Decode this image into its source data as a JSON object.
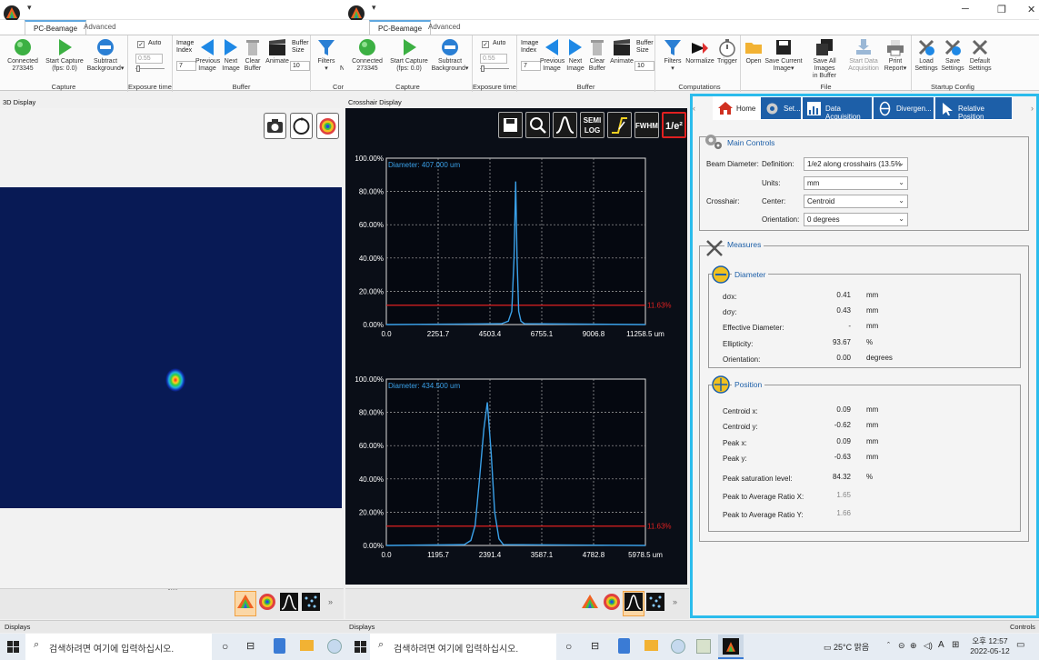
{
  "left_window": {
    "ribbon_tabs": [
      "PC-Beamage",
      "Advanced"
    ],
    "capture": {
      "connected_label": "Connected",
      "connected_id": "273345",
      "start_capture": "Start Capture",
      "fps": "(fps: 0.0)",
      "subtract": "Subtract",
      "background": "Background",
      "group_label": "Capture"
    },
    "exposure": {
      "auto_label": "Auto",
      "value": "0.55",
      "group_label": "Exposure time"
    },
    "buffer": {
      "image_index_label": "Image Index",
      "image_index_value": "7",
      "previous": "Previous",
      "next": "Next",
      "image": "Image",
      "clear": "Clear",
      "buffer_word": "Buffer",
      "animate": "Animate",
      "buffer_size_label": "Buffer Size",
      "buffer_size_value": "10",
      "group_label": "Buffer"
    },
    "filters_label": "Filters",
    "n_label": "N",
    "cor_label": "Cor",
    "panel_title": "3D Display"
  },
  "right_window": {
    "ribbon_tabs": [
      "PC-Beamage",
      "Advanced"
    ],
    "capture": {
      "connected_label": "Connected",
      "connected_id": "273345",
      "start_capture": "Start Capture",
      "fps": "(fps: 0.0)",
      "subtract": "Subtract",
      "background": "Background",
      "group_label": "Capture"
    },
    "exposure": {
      "auto_label": "Auto",
      "value": "0.55",
      "group_label": "Exposure time"
    },
    "buffer": {
      "image_index_label": "Image Index",
      "image_index_value": "7",
      "previous": "Previous",
      "next": "Next",
      "image": "Image",
      "clear": "Clear",
      "buffer_word": "Buffer",
      "animate": "Animate",
      "buffer_size_label": "Buffer Size",
      "buffer_size_value": "10",
      "group_label": "Buffer"
    },
    "computations": {
      "filters": "Filters",
      "normalize": "Normalize",
      "trigger": "Trigger",
      "group_label": "Computations"
    },
    "file": {
      "open": "Open",
      "save_current": "Save Current",
      "image": "Image",
      "save_all": "Save All Images",
      "in_buffer": "in Buffer",
      "start_data": "Start Data",
      "acquisition": "Acquisition",
      "print": "Print",
      "report": "Report",
      "group_label": "File"
    },
    "startup": {
      "load": "Load",
      "save": "Save",
      "default": "Default",
      "settings": "Settings",
      "group_label": "Startup Config"
    },
    "panel_title": "Crosshair Display",
    "toolbar_labels": [
      "SEMI LOG",
      "FWHM",
      "1/e²"
    ]
  },
  "chart_data": [
    {
      "type": "line",
      "title": "Diameter: 407.000 um",
      "x_ticks": [
        "0.0",
        "2251.7",
        "4503.4",
        "6755.1",
        "9006.8",
        "11258.5 um"
      ],
      "y_ticks": [
        "0.00%",
        "20.00%",
        "40.00%",
        "60.00%",
        "80.00%",
        "100.00%"
      ],
      "xlim": [
        0,
        11258.5
      ],
      "ylim": [
        0,
        100
      ],
      "threshold": {
        "value": 11.63,
        "label": "11.63%"
      },
      "x": [
        0,
        5000,
        5300,
        5450,
        5550,
        5620,
        5680,
        5750,
        5850,
        6000,
        11258.5
      ],
      "y": [
        0,
        0.5,
        2,
        8,
        40,
        86,
        40,
        8,
        2,
        0.5,
        0
      ],
      "grid": true
    },
    {
      "type": "line",
      "title": "Diameter: 434.500 um",
      "x_ticks": [
        "0.0",
        "1195.7",
        "2391.4",
        "3587.1",
        "4782.8",
        "5978.5 um"
      ],
      "y_ticks": [
        "0.00%",
        "20.00%",
        "40.00%",
        "60.00%",
        "80.00%",
        "100.00%"
      ],
      "xlim": [
        0,
        5978.5
      ],
      "ylim": [
        0,
        100
      ],
      "threshold": {
        "value": 11.63,
        "label": "11.63%"
      },
      "x": [
        0,
        1800,
        1950,
        2050,
        2150,
        2250,
        2330,
        2420,
        2500,
        2600,
        2700,
        5978.5
      ],
      "y": [
        0,
        0.5,
        3,
        12,
        40,
        70,
        86,
        55,
        20,
        4,
        0.5,
        0
      ],
      "grid": true
    }
  ],
  "right_panel": {
    "tabs": [
      "Home",
      "Set...",
      "Data Acquisition",
      "Divergen...",
      "Relative Position"
    ],
    "main_controls": {
      "title": "Main Controls",
      "beam_diameter_label": "Beam Diameter:",
      "definition_label": "Definition:",
      "definition_value": "1/e2 along crosshairs (13.5%",
      "units_label": "Units:",
      "units_value": "mm",
      "crosshair_label": "Crosshair:",
      "center_label": "Center:",
      "center_value": "Centroid",
      "orientation_label": "Orientation:",
      "orientation_value": "0 degrees"
    },
    "measures_title": "Measures",
    "diameter": {
      "title": "Diameter",
      "rows": [
        {
          "label": "dσx:",
          "value": "0.41",
          "unit": "mm"
        },
        {
          "label": "dσy:",
          "value": "0.43",
          "unit": "mm"
        },
        {
          "label": "Effective Diameter:",
          "value": "-",
          "unit": "mm"
        },
        {
          "label": "Ellipticity:",
          "value": "93.67",
          "unit": "%"
        },
        {
          "label": "Orientation:",
          "value": "0.00",
          "unit": "degrees"
        }
      ]
    },
    "position": {
      "title": "Position",
      "rows": [
        {
          "label": "Centroid x:",
          "value": "0.09",
          "unit": "mm"
        },
        {
          "label": "Centroid y:",
          "value": "-0.62",
          "unit": "mm"
        },
        {
          "label": "Peak x:",
          "value": "0.09",
          "unit": "mm"
        },
        {
          "label": "Peak y:",
          "value": "-0.63",
          "unit": "mm"
        },
        {
          "label": "Peak saturation level:",
          "value": "84.32",
          "unit": "%"
        },
        {
          "label": "Peak to Average Ratio X:",
          "value": "1.65",
          "unit": ""
        },
        {
          "label": "Peak to Average Ratio Y:",
          "value": "1.66",
          "unit": ""
        }
      ]
    }
  },
  "status": {
    "left": "Displays",
    "middle": "Displays",
    "right": "Controls"
  },
  "taskbar": {
    "search_placeholder": "검색하려면 여기에 입력하십시오.",
    "weather": "25°C 맑음",
    "ime": "A",
    "time_period": "오후 12:57",
    "date": "2022-05-12"
  },
  "colors": {
    "accent": "#2bbcec",
    "tab_blue": "#1d5fa8",
    "plot_line": "#3aa0e8",
    "threshold": "#e02020"
  }
}
